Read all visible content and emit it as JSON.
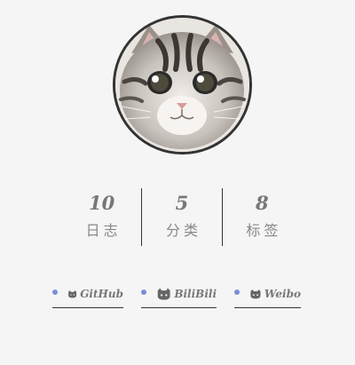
{
  "profile": {
    "avatar_alt": "cat avatar"
  },
  "stats": [
    {
      "count": "10",
      "label": "日志"
    },
    {
      "count": "5",
      "label": "分类"
    },
    {
      "count": "8",
      "label": "标签"
    }
  ],
  "links": [
    {
      "label": "GitHub",
      "icon": "github-icon"
    },
    {
      "label": "BiliBili",
      "icon": "github-icon"
    },
    {
      "label": "Weibo",
      "icon": "github-icon"
    }
  ],
  "colors": {
    "dot": "#7b8fd8",
    "divider": "#333333",
    "background": "#f5f5f5"
  }
}
